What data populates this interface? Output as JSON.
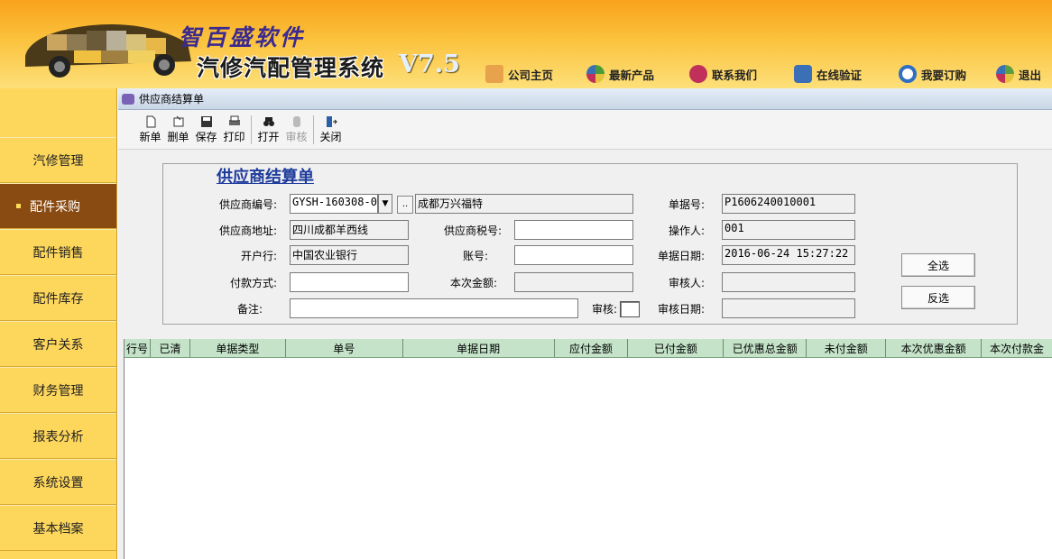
{
  "header": {
    "brand": "智百盛软件",
    "system_name": "汽修汽配管理系统",
    "version": "V7.5",
    "nav": [
      {
        "label": "公司主页",
        "icon": "home-icon",
        "color": "#e8a24b"
      },
      {
        "label": "最新产品",
        "icon": "pinwheel-icon",
        "color": "#4a9b3a"
      },
      {
        "label": "联系我们",
        "icon": "contact-icon",
        "color": "#c0305a"
      },
      {
        "label": "在线验证",
        "icon": "link-icon",
        "color": "#3b6fb6"
      },
      {
        "label": "我要订购",
        "icon": "search-icon",
        "color": "#2f6ec3"
      },
      {
        "label": "退出",
        "icon": "exit-icon",
        "color": "#5aa040"
      }
    ]
  },
  "sidebar": {
    "items": [
      {
        "label": "汽修管理"
      },
      {
        "label": "配件采购"
      },
      {
        "label": "配件销售"
      },
      {
        "label": "配件库存"
      },
      {
        "label": "客户关系"
      },
      {
        "label": "财务管理"
      },
      {
        "label": "报表分析"
      },
      {
        "label": "系统设置"
      },
      {
        "label": "基本档案"
      }
    ]
  },
  "window": {
    "title": "供应商结算单"
  },
  "toolbar": {
    "new": "新单",
    "delete": "删单",
    "save": "保存",
    "print": "打印",
    "open": "打开",
    "audit": "审核",
    "close": "关闭"
  },
  "form": {
    "title": "供应商结算单",
    "supplier_code_label": "供应商编号:",
    "supplier_code": "GYSH-160308-0(",
    "supplier_name": "成都万兴福特",
    "doc_no_label": "单据号:",
    "doc_no": "P1606240010001",
    "address_label": "供应商地址:",
    "address": "四川成都羊西线",
    "tax_no_label": "供应商税号:",
    "tax_no": "",
    "operator_label": "操作人:",
    "operator": "001",
    "bank_label": "开户行:",
    "bank": "中国农业银行",
    "account_label": "账号:",
    "account": "",
    "doc_date_label": "单据日期:",
    "doc_date": "2016-06-24 15:27:22",
    "pay_method_label": "付款方式:",
    "pay_method": "",
    "amount_label": "本次金额:",
    "amount": "",
    "auditor_label": "审核人:",
    "auditor": "",
    "remark_label": "备注:",
    "remark": "",
    "audit_label": "审核:",
    "audit_date_label": "审核日期:",
    "audit_date": "",
    "select_all": "全选",
    "invert_select": "反选"
  },
  "grid": {
    "columns": [
      "行号",
      "已清",
      "单据类型",
      "单号",
      "单据日期",
      "应付金额",
      "已付金额",
      "已优惠总金额",
      "未付金额",
      "本次优惠金额",
      "本次付款金"
    ]
  }
}
